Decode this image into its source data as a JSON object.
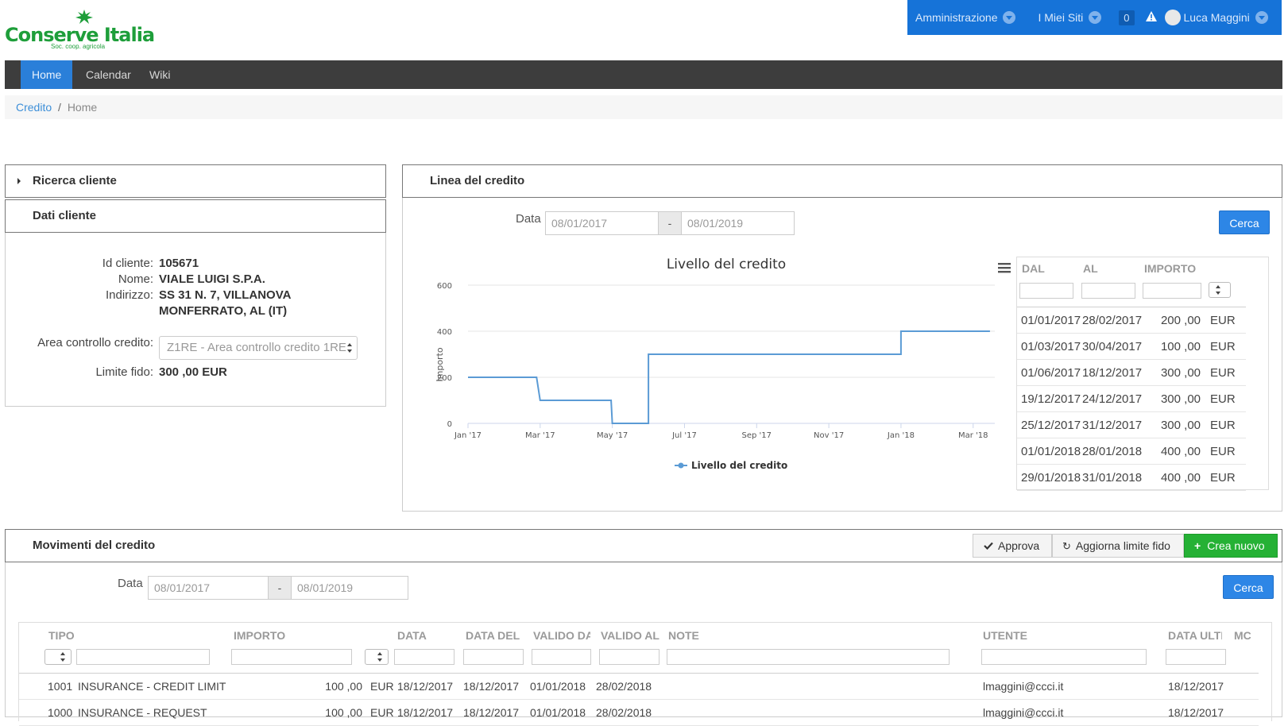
{
  "app": {
    "logo_main": "Conserve Italia",
    "logo_sub": "Soc. coop. agricola"
  },
  "topbar": {
    "administration": "Amministrazione",
    "my_sites": "I Miei Siti",
    "notifications_count": "0",
    "user_name": "Luca Maggini"
  },
  "nav": {
    "items": [
      "Home",
      "Calendar",
      "Wiki"
    ],
    "active": "Home"
  },
  "breadcrumb": {
    "root": "Credito",
    "separator": "/",
    "current": "Home"
  },
  "search_panel": {
    "title": "Ricerca cliente"
  },
  "client_panel": {
    "title": "Dati cliente",
    "id_label": "Id cliente:",
    "id_value": "105671",
    "name_label": "Nome:",
    "name_value": "VIALE LUIGI S.P.A.",
    "address_label": "Indirizzo:",
    "address_line1": "SS 31 N. 7, VILLANOVA",
    "address_line2": "MONFERRATO, AL (IT)",
    "area_label": "Area controllo credito:",
    "area_value": "Z1RE - Area controllo credito 1RE",
    "limit_label": "Limite fido:",
    "limit_value": "300 ,00 EUR"
  },
  "credit_line": {
    "title": "Linea del credito",
    "date_label": "Data",
    "date_from": "08/01/2017",
    "date_sep": "-",
    "date_to": "08/01/2019",
    "search_button": "Cerca",
    "table": {
      "headers": [
        "DAL",
        "AL",
        "IMPORTO"
      ],
      "rows": [
        {
          "dal": "01/01/2017",
          "al": "28/02/2017",
          "importo": "200 ,00",
          "cur": "EUR"
        },
        {
          "dal": "01/03/2017",
          "al": "30/04/2017",
          "importo": "100 ,00",
          "cur": "EUR"
        },
        {
          "dal": "01/06/2017",
          "al": "18/12/2017",
          "importo": "300 ,00",
          "cur": "EUR"
        },
        {
          "dal": "19/12/2017",
          "al": "24/12/2017",
          "importo": "300 ,00",
          "cur": "EUR"
        },
        {
          "dal": "25/12/2017",
          "al": "31/12/2017",
          "importo": "300 ,00",
          "cur": "EUR"
        },
        {
          "dal": "01/01/2018",
          "al": "28/01/2018",
          "importo": "400 ,00",
          "cur": "EUR"
        },
        {
          "dal": "29/01/2018",
          "al": "31/01/2018",
          "importo": "400 ,00",
          "cur": "EUR"
        }
      ]
    }
  },
  "chart_data": {
    "type": "line",
    "title": "Livello del credito",
    "xlabel": "",
    "ylabel": "Importo",
    "ylim": [
      0,
      600
    ],
    "yticks": [
      0,
      200,
      400,
      600
    ],
    "xtick_labels": [
      "Jan '17",
      "Mar '17",
      "May '17",
      "Jul '17",
      "Sep '17",
      "Nov '17",
      "Jan '18",
      "Mar '18"
    ],
    "xlim_months": [
      0,
      14.6
    ],
    "step": true,
    "grid": true,
    "legend": "bottom-center",
    "line_color": "#5b9bd5",
    "series": [
      {
        "name": "Livello del credito",
        "points": [
          {
            "x": "01/01/2017",
            "y": 200
          },
          {
            "x": "28/02/2017",
            "y": 200
          },
          {
            "x": "01/03/2017",
            "y": 100
          },
          {
            "x": "30/04/2017",
            "y": 100
          },
          {
            "x": "01/05/2017",
            "y": 0
          },
          {
            "x": "31/05/2017",
            "y": 0
          },
          {
            "x": "01/06/2017",
            "y": 300
          },
          {
            "x": "31/12/2017",
            "y": 300
          },
          {
            "x": "01/01/2018",
            "y": 400
          },
          {
            "x": "15/03/2018",
            "y": 400
          }
        ]
      }
    ]
  },
  "movements": {
    "title": "Movimenti del credito",
    "approve_button": "Approva",
    "update_limit_button": "Aggiorna limite fido",
    "create_button": "Crea nuovo",
    "date_label": "Data",
    "date_from": "08/01/2017",
    "date_sep": "-",
    "date_to": "08/01/2019",
    "search_button": "Cerca",
    "headers": [
      "TIPO",
      "IMPORTO",
      "DATA",
      "DATA DELI",
      "VALIDO DA",
      "VALIDO AL",
      "NOTE",
      "UTENTE",
      "DATA ULTI",
      "MC"
    ],
    "rows": [
      {
        "code": "1001",
        "type": "INSURANCE - CREDIT LIMIT",
        "amount": "100 ,00",
        "cur": "EUR",
        "date": "18/12/2017",
        "delivery": "18/12/2017",
        "valid_from": "01/01/2018",
        "valid_to": "28/02/2018",
        "note": "",
        "user": "lmaggini@ccci.it",
        "last": "18/12/2017"
      },
      {
        "code": "1000",
        "type": "INSURANCE - REQUEST",
        "amount": "100 ,00",
        "cur": "EUR",
        "date": "18/12/2017",
        "delivery": "18/12/2017",
        "valid_from": "01/01/2018",
        "valid_to": "28/02/2018",
        "note": "",
        "user": "lmaggini@ccci.it",
        "last": "18/12/2017"
      }
    ]
  }
}
